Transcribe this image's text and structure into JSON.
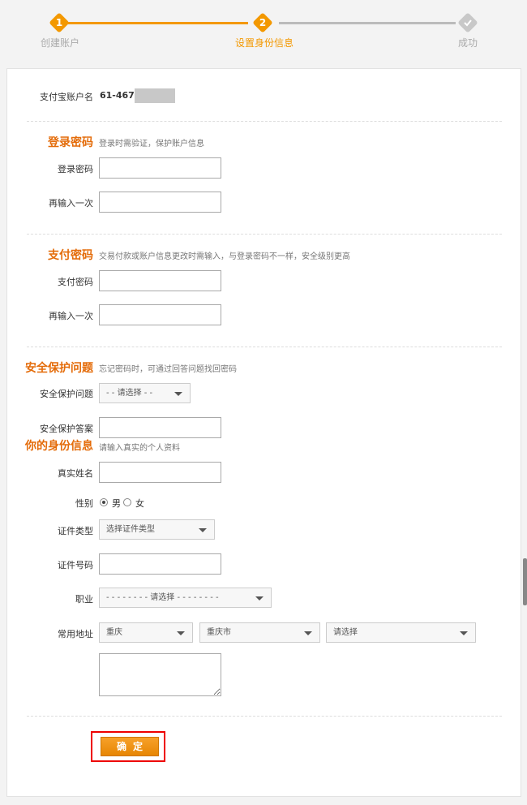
{
  "stepper": {
    "steps": [
      {
        "number": "1",
        "label": "创建账户"
      },
      {
        "number": "2",
        "label": "设置身份信息"
      },
      {
        "label": "成功"
      }
    ]
  },
  "account": {
    "label": "支付宝账户名",
    "value": "61-467"
  },
  "login_password": {
    "title": "登录密码",
    "hint": "登录时需验证，保护账户信息",
    "password_label": "登录密码",
    "confirm_label": "再输入一次"
  },
  "pay_password": {
    "title": "支付密码",
    "hint": "交易付款或账户信息更改时需输入，与登录密码不一样，安全级别更高",
    "password_label": "支付密码",
    "confirm_label": "再输入一次"
  },
  "security": {
    "title": "安全保护问题",
    "hint": "忘记密码时，可通过回答问题找回密码",
    "question_label": "安全保护问题",
    "question_value": "- - 请选择 - -",
    "answer_label": "安全保护答案"
  },
  "identity": {
    "title": "你的身份信息",
    "hint": "请输入真实的个人资料",
    "name_label": "真实姓名",
    "gender_label": "性别",
    "gender_male": "男",
    "gender_female": "女",
    "id_type_label": "证件类型",
    "id_type_value": "选择证件类型",
    "id_number_label": "证件号码",
    "occupation_label": "职业",
    "occupation_value": "- - - - - - - - 请选择 - - - - - - - -",
    "address_label": "常用地址",
    "province_value": "重庆",
    "city_value": "重庆市",
    "district_value": "请选择"
  },
  "submit_label": "确定"
}
